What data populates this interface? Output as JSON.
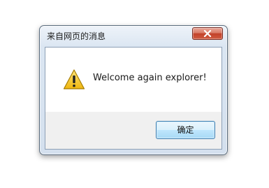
{
  "window": {
    "title": "来自网页的消息"
  },
  "titlebar": {
    "close_icon": "close-icon"
  },
  "message": {
    "icon": "warning-icon",
    "text": "Welcome again explorer!"
  },
  "buttons": {
    "ok_label": "确定"
  },
  "colors": {
    "close_button": "#c94a33",
    "warning_fill": "#f5c518",
    "ok_button_border": "#3c7fb1"
  }
}
